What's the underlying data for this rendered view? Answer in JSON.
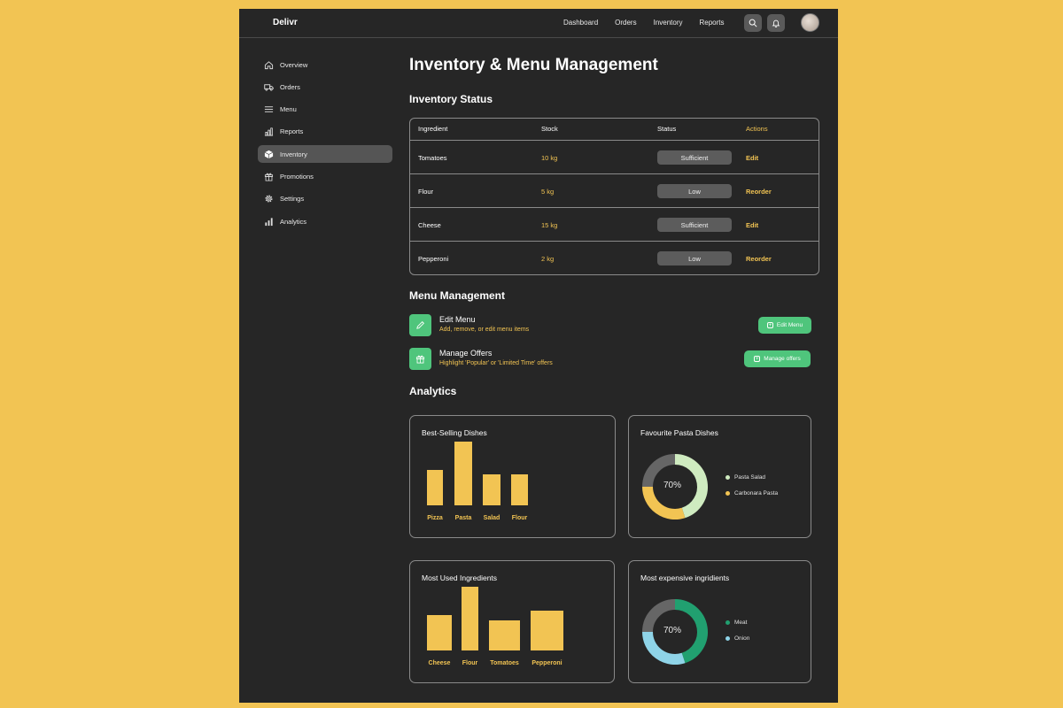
{
  "app": {
    "brand": "Delivr"
  },
  "topnav": [
    "Dashboard",
    "Orders",
    "Inventory",
    "Reports"
  ],
  "sidebar": {
    "items": [
      {
        "label": "Overview",
        "icon": "home-icon"
      },
      {
        "label": "Orders",
        "icon": "truck-icon"
      },
      {
        "label": "Menu",
        "icon": "menu-lines-icon"
      },
      {
        "label": "Reports",
        "icon": "bar-chart-icon"
      },
      {
        "label": "Inventory",
        "icon": "box-icon",
        "active": true
      },
      {
        "label": "Promotions",
        "icon": "gift-icon"
      },
      {
        "label": "Settings",
        "icon": "gear-icon"
      },
      {
        "label": "Analytics",
        "icon": "analytics-icon"
      }
    ]
  },
  "page": {
    "title": "Inventory & Menu Management"
  },
  "inventory": {
    "heading": "Inventory Status",
    "columns": [
      "Ingredient",
      "Stock",
      "Status",
      "Actions"
    ],
    "rows": [
      {
        "ingredient": "Tomatoes",
        "stock": "10 kg",
        "status": "Sufficient",
        "action": "Edit"
      },
      {
        "ingredient": "Flour",
        "stock": "5 kg",
        "status": "Low",
        "action": "Reorder"
      },
      {
        "ingredient": "Cheese",
        "stock": "15 kg",
        "status": "Sufficient",
        "action": "Edit"
      },
      {
        "ingredient": "Pepperoni",
        "stock": "2 kg",
        "status": "Low",
        "action": "Reorder"
      }
    ]
  },
  "menu_management": {
    "heading": "Menu Management",
    "items": [
      {
        "title": "Edit Menu",
        "subtitle": "Add, remove, or edit menu items",
        "button": "Edit Menu",
        "icon": "pencil-icon"
      },
      {
        "title": "Manage Offers",
        "subtitle": "Highlight 'Popular' or 'Limited Time' offers",
        "button": "Manage offers",
        "icon": "gift-icon"
      }
    ]
  },
  "analytics": {
    "heading": "Analytics",
    "cards": [
      {
        "title": "Best-Selling Dishes"
      },
      {
        "title": "Favourite Pasta Dishes"
      },
      {
        "title": "Most Used Ingredients"
      },
      {
        "title": "Most expensive ingridients"
      }
    ]
  },
  "colors": {
    "accent": "#F2C453",
    "green": "#4FC57C",
    "background": "#262626",
    "outer": "#F2C453"
  },
  "chart_data": [
    {
      "type": "bar",
      "title": "Best-Selling Dishes",
      "categories": [
        "Pizza",
        "Pasta",
        "Salad",
        "Flour"
      ],
      "values": [
        40,
        72,
        35,
        35
      ],
      "ylim": [
        0,
        72
      ]
    },
    {
      "type": "pie",
      "title": "Favourite Pasta Dishes",
      "center_label": "70%",
      "series": [
        {
          "name": "Pasta Salad",
          "value": 45,
          "color": "#CFEBC0"
        },
        {
          "name": "Carbonara Pasta",
          "value": 30,
          "color": "#F2C453"
        },
        {
          "name": "",
          "value": 25,
          "color": "#666666"
        }
      ]
    },
    {
      "type": "bar",
      "title": "Most Used Ingredients",
      "categories": [
        "Cheese",
        "Flour",
        "Tomatoes",
        "Pepperoni"
      ],
      "values": [
        40,
        72,
        34,
        45
      ],
      "ylim": [
        0,
        72
      ]
    },
    {
      "type": "pie",
      "title": "Most expensive ingridients",
      "center_label": "70%",
      "series": [
        {
          "name": "Meat",
          "value": 45,
          "color": "#21A070"
        },
        {
          "name": "Onion",
          "value": 30,
          "color": "#8FD4E8"
        },
        {
          "name": "",
          "value": 25,
          "color": "#666666"
        }
      ]
    }
  ]
}
